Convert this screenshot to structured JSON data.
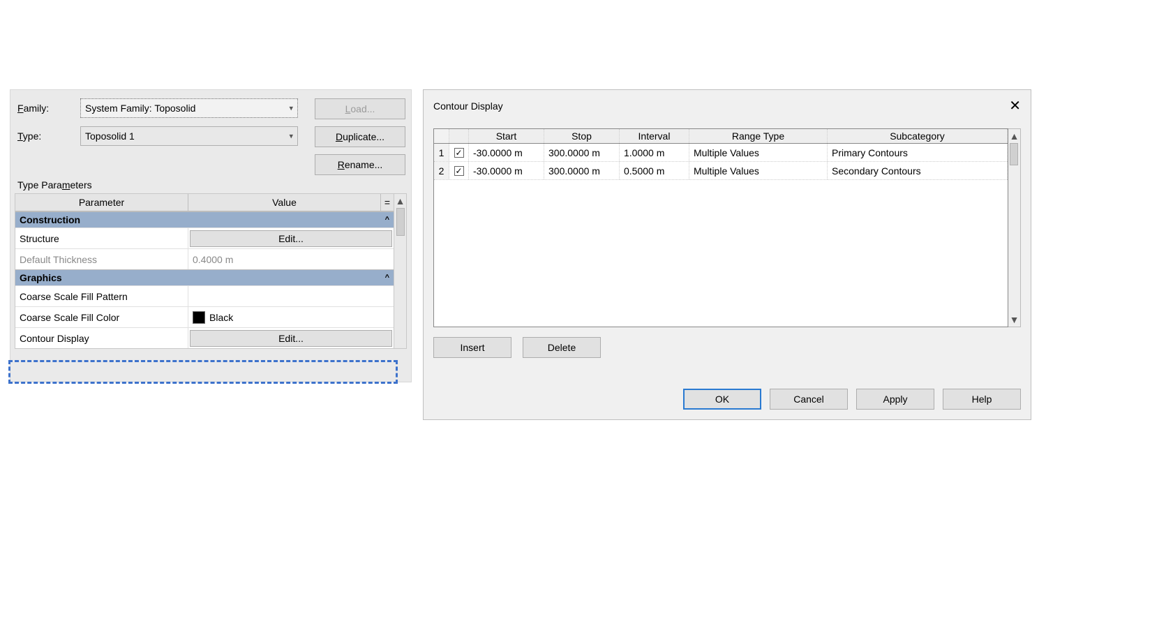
{
  "leftPanel": {
    "familyLabel": "Family:",
    "familyValue": "System Family: Toposolid",
    "typeLabel": "Type:",
    "typeValue": "Toposolid 1",
    "buttons": {
      "load": "Load...",
      "duplicate": "Duplicate...",
      "rename": "Rename..."
    },
    "tpLabel": "Type Parameters",
    "headers": {
      "param": "Parameter",
      "value": "Value",
      "eq": "="
    },
    "groups": {
      "construction": "Construction",
      "graphics": "Graphics"
    },
    "rows": {
      "structure": {
        "name": "Structure",
        "action": "Edit..."
      },
      "defaultThickness": {
        "name": "Default Thickness",
        "value": "0.4000 m"
      },
      "coarsePattern": {
        "name": "Coarse Scale Fill Pattern",
        "value": ""
      },
      "coarseColor": {
        "name": "Coarse Scale Fill Color",
        "value": "Black"
      },
      "contourDisplay": {
        "name": "Contour Display",
        "action": "Edit..."
      }
    }
  },
  "rightDialog": {
    "title": "Contour Display",
    "headers": {
      "start": "Start",
      "stop": "Stop",
      "interval": "Interval",
      "range": "Range Type",
      "sub": "Subcategory"
    },
    "rows": [
      {
        "idx": "1",
        "checked": true,
        "start": "-30.0000 m",
        "stop": "300.0000 m",
        "interval": "1.0000 m",
        "range": "Multiple Values",
        "sub": "Primary Contours"
      },
      {
        "idx": "2",
        "checked": true,
        "start": "-30.0000 m",
        "stop": "300.0000 m",
        "interval": "0.5000 m",
        "range": "Multiple Values",
        "sub": "Secondary Contours"
      }
    ],
    "buttons": {
      "insert": "Insert",
      "delete": "Delete",
      "ok": "OK",
      "cancel": "Cancel",
      "apply": "Apply",
      "help": "Help"
    }
  }
}
